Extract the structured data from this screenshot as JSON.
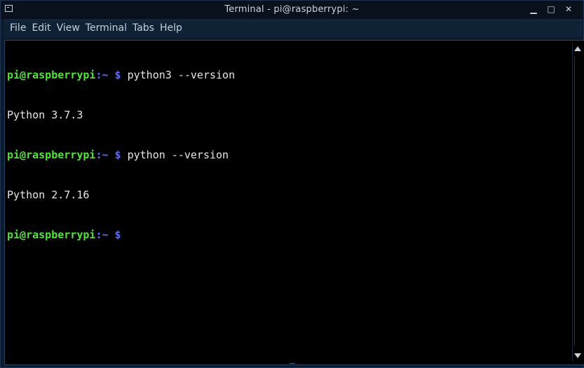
{
  "window": {
    "title": "Terminal - pi@raspberrypi: ~",
    "minimize_glyph": "▁",
    "maximize_glyph": "□",
    "close_glyph": "✕",
    "icon": "terminal-icon"
  },
  "menu": {
    "items": [
      "File",
      "Edit",
      "View",
      "Terminal",
      "Tabs",
      "Help"
    ]
  },
  "terminal": {
    "lines": [
      {
        "type": "prompt",
        "user": "pi@raspberrypi",
        "path": ":~",
        "dollar": " $",
        "command": " python3 --version"
      },
      {
        "type": "output",
        "text": "Python 3.7.3"
      },
      {
        "type": "prompt",
        "user": "pi@raspberrypi",
        "path": ":~",
        "dollar": " $",
        "command": " python --version"
      },
      {
        "type": "output",
        "text": "Python 2.7.16"
      },
      {
        "type": "prompt",
        "user": "pi@raspberrypi",
        "path": ":~",
        "dollar": " $",
        "command": ""
      }
    ]
  },
  "colors": {
    "prompt_user": "#52e23a",
    "prompt_path": "#5b6cff",
    "background": "#000000",
    "text": "#e6e6e6"
  }
}
